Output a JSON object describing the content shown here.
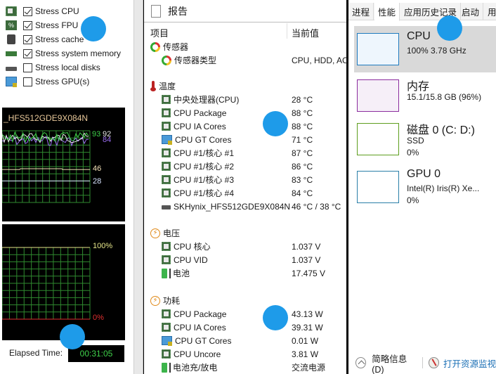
{
  "stress": {
    "items": [
      {
        "label": "Stress CPU",
        "checked": true,
        "icon": "cpu-chip-icon"
      },
      {
        "label": "Stress FPU",
        "checked": true,
        "icon": "fpu-chip-icon"
      },
      {
        "label": "Stress cache",
        "checked": true,
        "icon": "cache-chip-icon"
      },
      {
        "label": "Stress system memory",
        "checked": true,
        "icon": "memory-module-icon"
      },
      {
        "label": "Stress local disks",
        "checked": false,
        "icon": "disk-drive-icon"
      },
      {
        "label": "Stress GPU(s)",
        "checked": false,
        "icon": "gpu-monitor-icon"
      }
    ]
  },
  "temp_graph": {
    "title": "_HFS512GDE9X084N",
    "labels": {
      "a": "93",
      "b": "92",
      "c": "84",
      "d": "46",
      "e": "28"
    },
    "colors": {
      "a": "#3fd24a",
      "b": "#e8e8e8",
      "c": "#9a6cf0",
      "d": "#f4e2b8",
      "e": "#d8e4ff"
    }
  },
  "usage_graph": {
    "top_label": "100%",
    "bottom_label": "0%",
    "top_color": "#e6e68a",
    "bottom_color": "#e03030"
  },
  "elapsed": {
    "label": "Elapsed Time:",
    "value": "00:31:05"
  },
  "report": {
    "title": "报告",
    "columns": {
      "item": "项目",
      "value": "当前值"
    },
    "sections": {
      "sensor": {
        "title": "传感器",
        "rows": [
          {
            "name": "传感器类型",
            "value": "CPU, HDD, AC"
          }
        ]
      },
      "temperature": {
        "title": "温度",
        "rows": [
          {
            "name": "中央处理器(CPU)",
            "value": "28 °C"
          },
          {
            "name": "CPU Package",
            "value": "88 °C"
          },
          {
            "name": "CPU IA Cores",
            "value": "88 °C"
          },
          {
            "name": "CPU GT Cores",
            "value": "71 °C"
          },
          {
            "name": "CPU #1/核心 #1",
            "value": "87 °C"
          },
          {
            "name": "CPU #1/核心 #2",
            "value": "86 °C"
          },
          {
            "name": "CPU #1/核心 #3",
            "value": "83 °C"
          },
          {
            "name": "CPU #1/核心 #4",
            "value": "84 °C"
          },
          {
            "name": "SKHynix_HFS512GDE9X084N",
            "value": "46 °C / 38 °C"
          }
        ]
      },
      "voltage": {
        "title": "电压",
        "rows": [
          {
            "name": "CPU 核心",
            "value": "1.037 V"
          },
          {
            "name": "CPU VID",
            "value": "1.037 V"
          },
          {
            "name": "电池",
            "value": "17.475 V"
          }
        ]
      },
      "power": {
        "title": "功耗",
        "rows": [
          {
            "name": "CPU Package",
            "value": "43.13 W"
          },
          {
            "name": "CPU IA Cores",
            "value": "39.31 W"
          },
          {
            "name": "CPU GT Cores",
            "value": "0.01 W"
          },
          {
            "name": "CPU Uncore",
            "value": "3.81 W"
          },
          {
            "name": "电池充/放电",
            "value": "交流电源"
          }
        ]
      }
    }
  },
  "taskmgr": {
    "tabs": [
      "进程",
      "性能",
      "应用历史记录",
      "启动",
      "用"
    ],
    "active_tab": "性能",
    "resources": [
      {
        "title": "CPU",
        "line1": "100%  3.78 GHz",
        "line2": "",
        "color": "#1f7bbf",
        "fill": "#eef6fd"
      },
      {
        "title": "内存",
        "line1": "15.1/15.8 GB (96%)",
        "line2": "",
        "color": "#8b2c9e",
        "fill": "#f6eff8"
      },
      {
        "title": "磁盘 0 (C: D:)",
        "line1": "SSD",
        "line2": "0%",
        "color": "#5e9e1e",
        "fill": "#ffffff"
      },
      {
        "title": "GPU 0",
        "line1": "Intel(R) Iris(R) Xe...",
        "line2": "0%",
        "color": "#2a7fa8",
        "fill": "#ffffff"
      }
    ],
    "footer": {
      "summary": "简略信息(D)",
      "monitor": "打开资源监视"
    }
  }
}
